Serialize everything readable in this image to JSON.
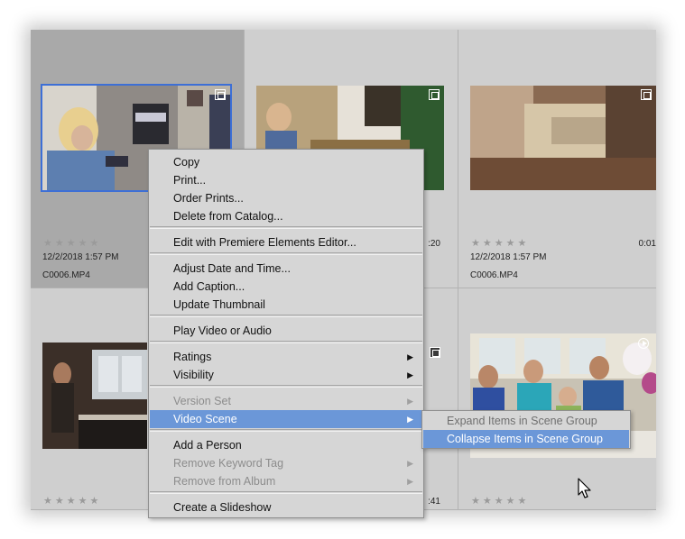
{
  "grid": {
    "cells": [
      {
        "stars": "★★★★★",
        "date": "12/2/2018 1:57 PM",
        "file": "C0006.MP4",
        "duration": ""
      },
      {
        "stars": "",
        "date": "",
        "file": "",
        "duration": ":20"
      },
      {
        "stars": "★★★★★",
        "date": "12/2/2018 1:57 PM",
        "file": "C0006.MP4",
        "duration": "0:01"
      },
      {
        "stars": "★★★★★",
        "date": "",
        "file": "",
        "duration": ""
      },
      {
        "stars": "",
        "date": "",
        "file": "",
        "duration": ":41"
      },
      {
        "stars": "★★★★★",
        "date": "",
        "file": "",
        "duration": ""
      }
    ]
  },
  "context_menu": {
    "items": [
      {
        "label": "Copy"
      },
      {
        "label": "Print..."
      },
      {
        "label": "Order Prints..."
      },
      {
        "label": "Delete from Catalog..."
      },
      {
        "label": "Edit with Premiere Elements Editor..."
      },
      {
        "label": "Adjust Date and Time..."
      },
      {
        "label": "Add Caption..."
      },
      {
        "label": "Update Thumbnail"
      },
      {
        "label": "Play Video or Audio"
      },
      {
        "label": "Ratings"
      },
      {
        "label": "Visibility"
      },
      {
        "label": "Version Set"
      },
      {
        "label": "Video Scene"
      },
      {
        "label": "Add a Person"
      },
      {
        "label": "Remove Keyword Tag"
      },
      {
        "label": "Remove from Album"
      },
      {
        "label": "Create a Slideshow"
      }
    ],
    "submenu_arrow": "▶"
  },
  "submenu": {
    "items": [
      {
        "label": "Expand Items in Scene Group"
      },
      {
        "label": "Collapse Items in Scene Group"
      }
    ]
  },
  "colors": {
    "highlight": "#6b97d8",
    "selection_border": "#3d6fd6",
    "grid_bg": "#cfcfcf",
    "selected_cell": "#a9a9a9"
  }
}
